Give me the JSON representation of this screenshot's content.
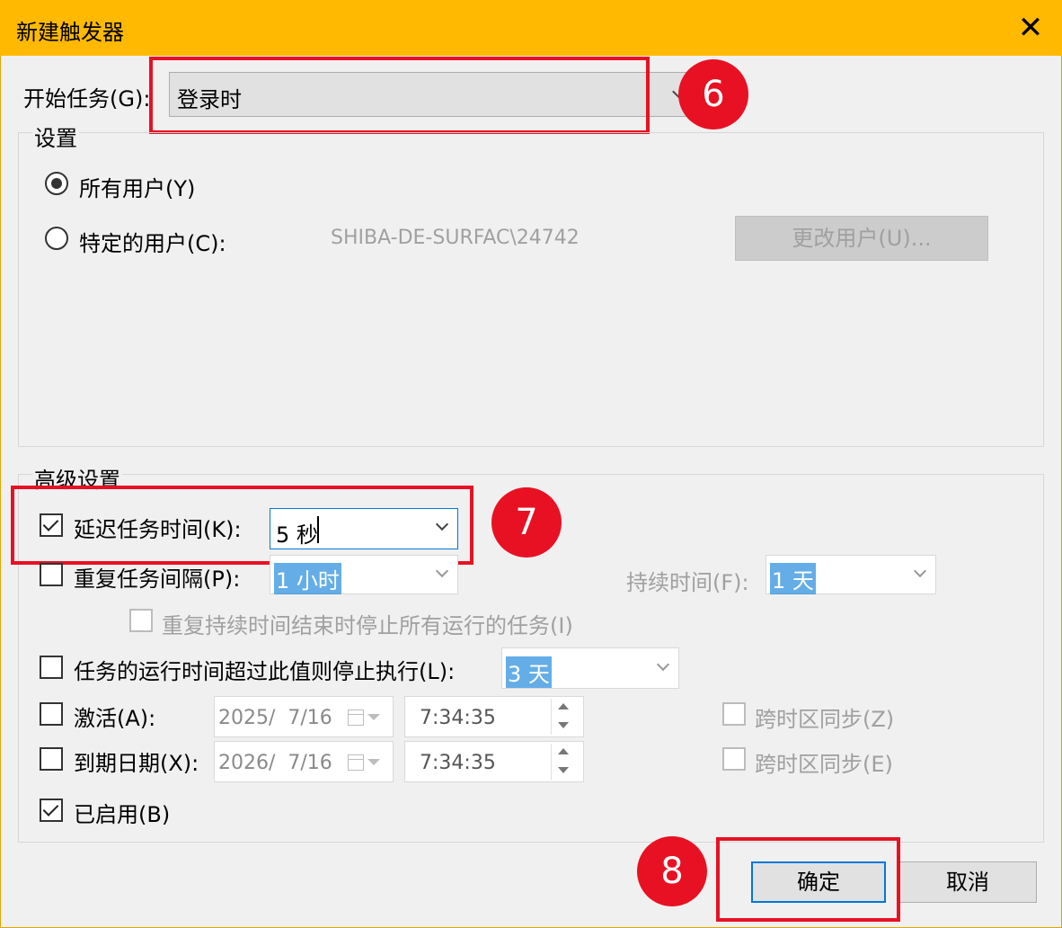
{
  "window": {
    "title": "新建触发器"
  },
  "begin": {
    "label": "开始任务(G):",
    "value": "登录时"
  },
  "settings": {
    "title": "设置",
    "all_users": "所有用户(Y)",
    "specific_user": "特定的用户(C):",
    "user_value": "SHIBA-DE-SURFAC\\24742",
    "change_user": "更改用户(U)..."
  },
  "advanced": {
    "title": "高级设置",
    "delay": {
      "label": "延迟任务时间(K):",
      "value": "5 秒",
      "checked": true
    },
    "repeat": {
      "label": "重复任务间隔(P):",
      "value": "1 小时",
      "checked": false
    },
    "duration": {
      "label": "持续时间(F):",
      "value": "1 天"
    },
    "stop_all": {
      "label": "重复持续时间结束时停止所有运行的任务(I)"
    },
    "stop_long": {
      "label": "任务的运行时间超过此值则停止执行(L):",
      "value": "3 天",
      "checked": false
    },
    "activate": {
      "label": "激活(A):",
      "date": "2025/  7/16",
      "time": "7:34:35",
      "sync": "跨时区同步(Z)"
    },
    "expire": {
      "label": "到期日期(X):",
      "date": "2026/  7/16",
      "time": "7:34:35",
      "sync": "跨时区同步(E)"
    },
    "enabled": {
      "label": "已启用(B)",
      "checked": true
    }
  },
  "buttons": {
    "ok": "确定",
    "cancel": "取消"
  },
  "annotations": {
    "step6": "6",
    "step7": "7",
    "step8": "8"
  },
  "colors": {
    "titlebar": "#ffb900",
    "highlight": "#e81123",
    "selection": "#0078d7"
  }
}
